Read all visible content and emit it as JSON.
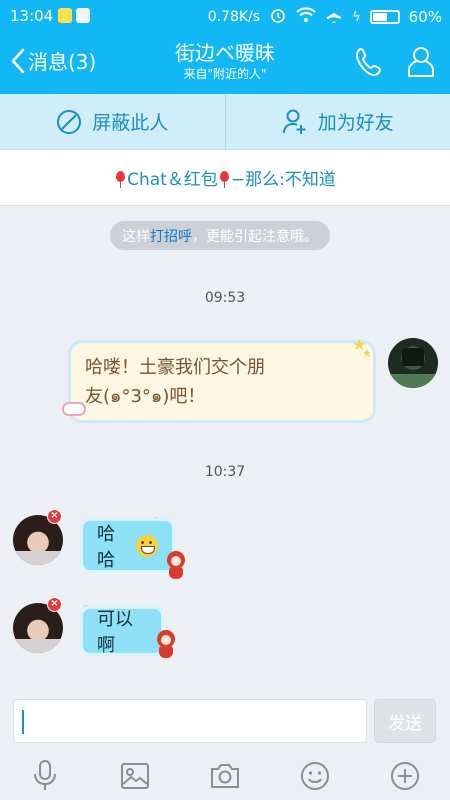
{
  "status_bar": {
    "time": "13:04",
    "network_speed": "0.78K/s",
    "battery_percent": "60%",
    "battery_level": 0.6
  },
  "header": {
    "back_label": "消息(3)",
    "title": "街边ベ暖昧",
    "subtitle": "来自\"附近的人\""
  },
  "actions": {
    "block_label": "屏蔽此人",
    "add_friend_label": "加为好友"
  },
  "banner": {
    "part1": "Chat＆红包",
    "part2": "−那么:不知道"
  },
  "hint": {
    "prefix": "这样",
    "link": "打招呼",
    "suffix": "，更能引起注意哦。"
  },
  "messages": [
    {
      "time": "09:53",
      "sender": "me",
      "text_line1": "哈喽！土豪我们交个朋",
      "text_line2": "友(๑°3°๑)吧！"
    },
    {
      "time": "10:37",
      "sender": "other",
      "text": "哈哈"
    },
    {
      "sender": "other",
      "text": "可以啊"
    }
  ],
  "composer": {
    "input_value": "",
    "send_label": "发送"
  },
  "toolbar": {
    "icons": [
      "microphone-icon",
      "image-icon",
      "camera-icon",
      "emoji-icon",
      "plus-icon"
    ]
  },
  "colors": {
    "primary": "#12b7f5",
    "action_bar_bg": "#cfeef9",
    "link": "#1b8ec2",
    "incoming_bubble": "#8de0f6",
    "outgoing_bubble": "#fdf6e3"
  }
}
